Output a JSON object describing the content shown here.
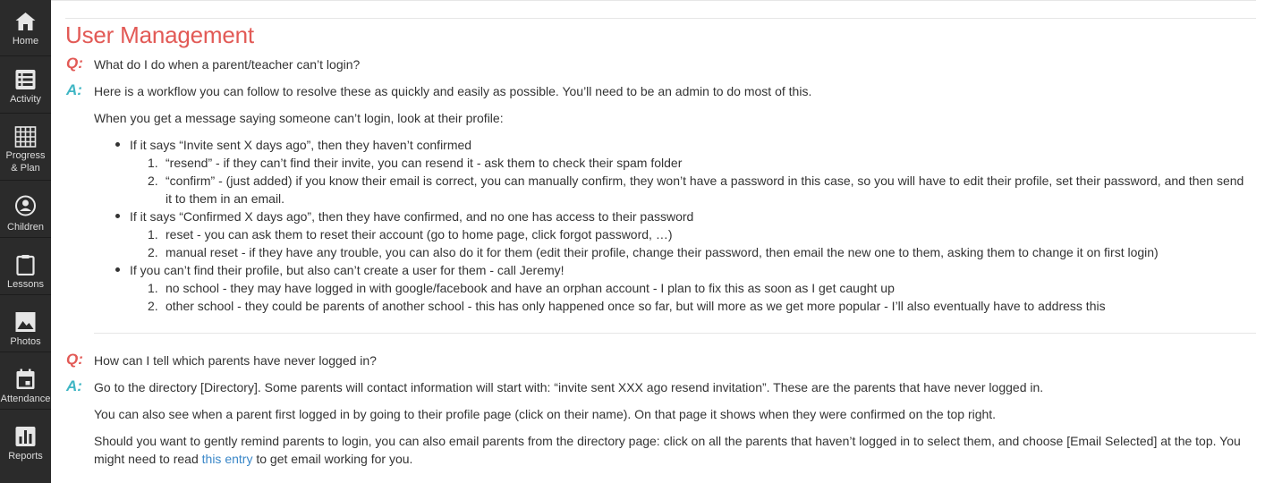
{
  "nav": {
    "home": "Home",
    "activity": "Activity",
    "progress_plan": "Progress\n& Plan",
    "children": "Children",
    "lessons": "Lessons",
    "photos": "Photos",
    "attendance": "Attendance",
    "reports": "Reports"
  },
  "section_title": "User Management",
  "q_mark": "Q:",
  "a_mark": "A:",
  "qa1": {
    "question": "What do I do when a parent/teacher can’t login?",
    "answer_intro": "Here is a workflow you can follow to resolve these as quickly and easily as possible. You’ll need to be an admin to do most of this.",
    "answer_lead": "When you get a message saying someone can’t login, look at their profile:",
    "bullets": [
      {
        "text": "If it says “Invite sent X days ago”, then they haven’t confirmed",
        "steps": [
          "“resend” - if they can’t find their invite, you can resend it - ask them to check their spam folder",
          "“confirm” - (just added) if you know their email is correct, you can manually confirm, they won’t have a password in this case, so you will have to edit their profile, set their password, and then send",
          "it to them in an email."
        ]
      },
      {
        "text": "If it says “Confirmed X days ago”, then they have confirmed, and no one has access to their password",
        "steps": [
          "reset - you can ask them to reset their account (go to home page, click forgot password, …)",
          "manual reset - if they have any trouble, you can also do it for them (edit their profile, change their password, then email the new one to them, asking them to change it on first login)"
        ]
      },
      {
        "text": "If you can’t find their profile, but also can’t create a user for them - call Jeremy!",
        "steps": [
          "no school - they may have logged in with google/facebook and have an orphan account - I plan to fix this as soon as I get caught up",
          "other school - they could be parents of another school - this has only happened once so far, but will more as we get more popular - I’ll also eventually have to address this"
        ]
      }
    ]
  },
  "qa2": {
    "question": "How can I tell which parents have never logged in?",
    "answer_p1": "Go to the directory [Directory]. Some parents will contact information will start with: “invite sent XXX ago resend invitation”. These are the parents that have never logged in.",
    "answer_p2": "You can also see when a parent first logged in by going to their profile page (click on their name). On that page it shows when they were confirmed on the top right.",
    "answer_p3_line1": "Should you want to gently remind parents to login, you can also email parents from the directory page: click on all the parents that haven’t logged in to select them, and choose [Email Selected] at the top. You",
    "answer_p3_line2_pre": "might need to read ",
    "answer_p3_link": "this entry",
    "answer_p3_line2_post": " to get email working for you."
  },
  "step_numbers": [
    "1.",
    "2."
  ]
}
